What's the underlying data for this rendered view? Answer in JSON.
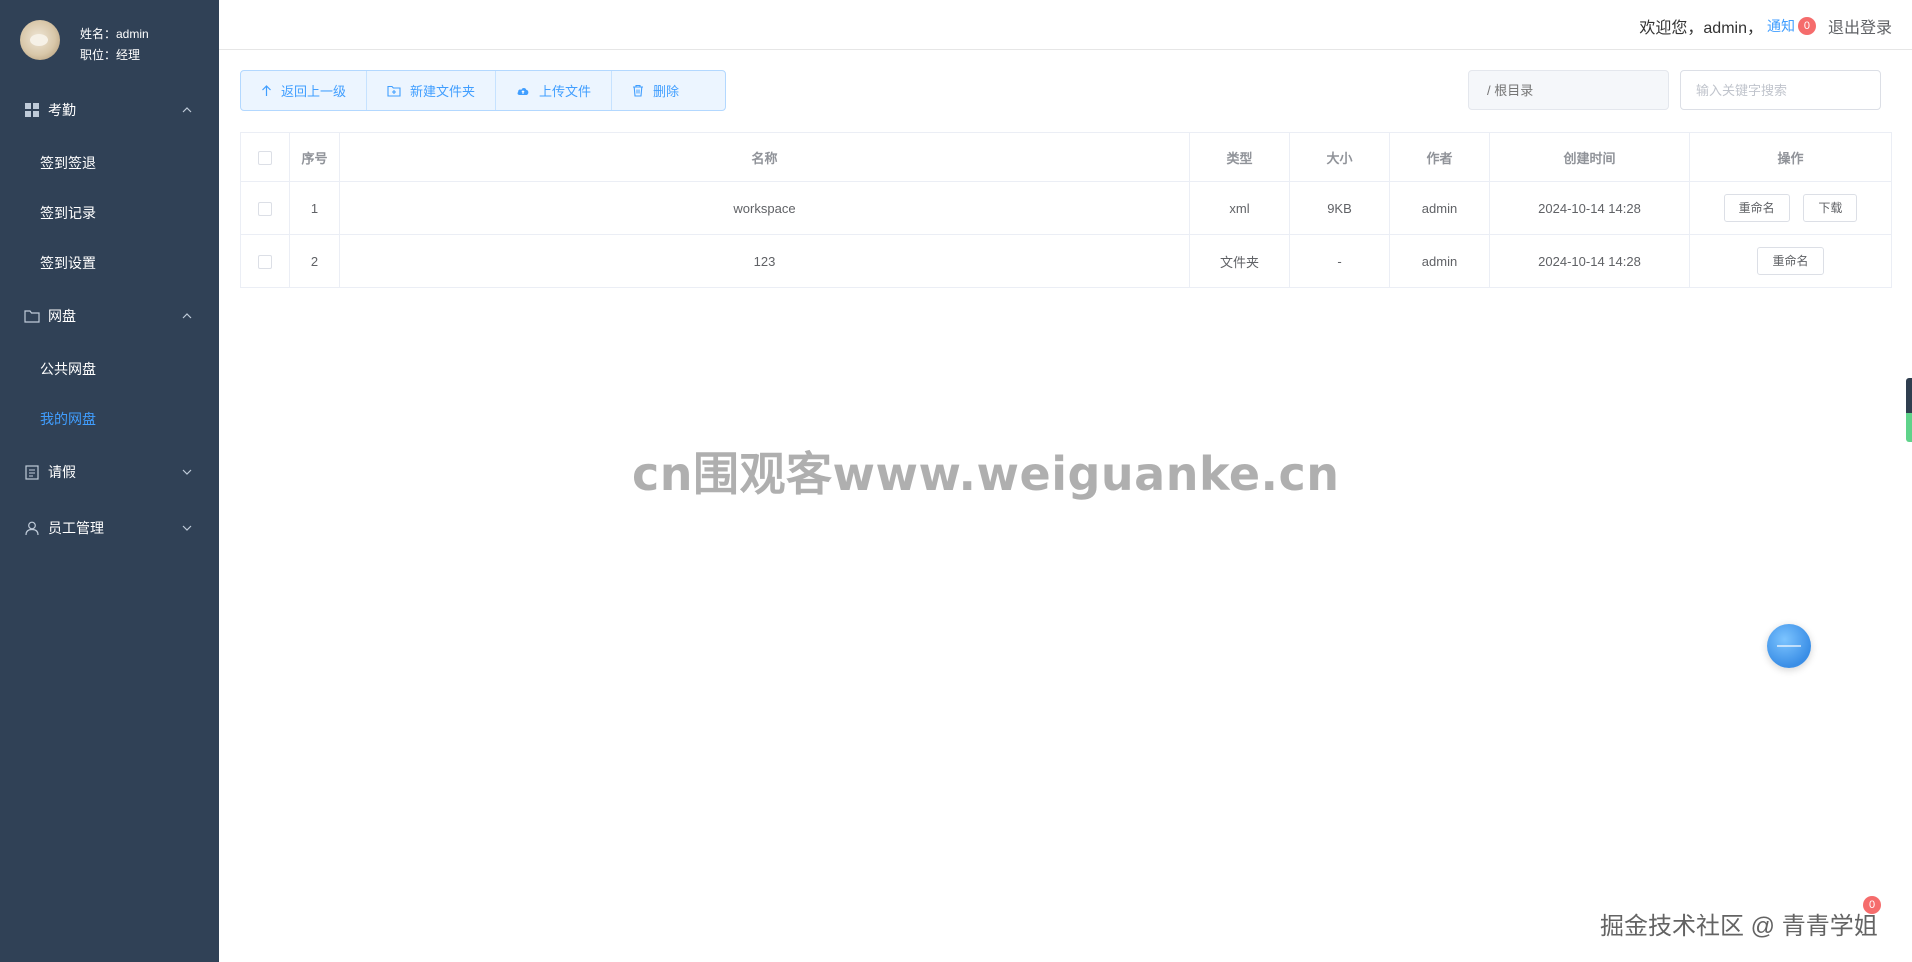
{
  "user": {
    "name_label": "姓名：admin",
    "role_label": "职位：经理"
  },
  "sidebar": {
    "groups": [
      {
        "label": "考勤",
        "icon": "grid-icon",
        "items": [
          "签到签退",
          "签到记录",
          "签到设置"
        ]
      },
      {
        "label": "网盘",
        "icon": "folder-icon",
        "items": [
          "公共网盘",
          "我的网盘"
        ],
        "active": "我的网盘"
      },
      {
        "label": "请假",
        "icon": "document-icon",
        "items": []
      },
      {
        "label": "员工管理",
        "icon": "user-icon",
        "items": []
      }
    ]
  },
  "header": {
    "welcome": "欢迎您，admin，",
    "notice": "通知",
    "notice_count": "0",
    "logout": "退出登录"
  },
  "toolbar": {
    "back": "返回上一级",
    "new_folder": "新建文件夹",
    "upload": "上传文件",
    "delete": "删除"
  },
  "path": {
    "placeholder": "/ 根目录"
  },
  "search": {
    "placeholder": "输入关键字搜索"
  },
  "table": {
    "headers": [
      "序号",
      "名称",
      "类型",
      "大小",
      "作者",
      "创建时间",
      "操作"
    ],
    "rows": [
      {
        "index": "1",
        "name": "workspace",
        "type": "xml",
        "size": "9KB",
        "author": "admin",
        "created": "2024-10-14 14:28",
        "actions": [
          "重命名",
          "下载"
        ]
      },
      {
        "index": "2",
        "name": "123",
        "type": "文件夹",
        "size": "-",
        "author": "admin",
        "created": "2024-10-14 14:28",
        "actions": [
          "重命名"
        ]
      }
    ]
  },
  "watermark": {
    "center": "cn围观客www.weiguanke.cn",
    "corner": "掘金技术社区 @ 青青学姐",
    "corner_badge": "0"
  },
  "colors": {
    "sidebar_bg": "#304156",
    "accent": "#409eff",
    "badge": "#f56c6c"
  }
}
